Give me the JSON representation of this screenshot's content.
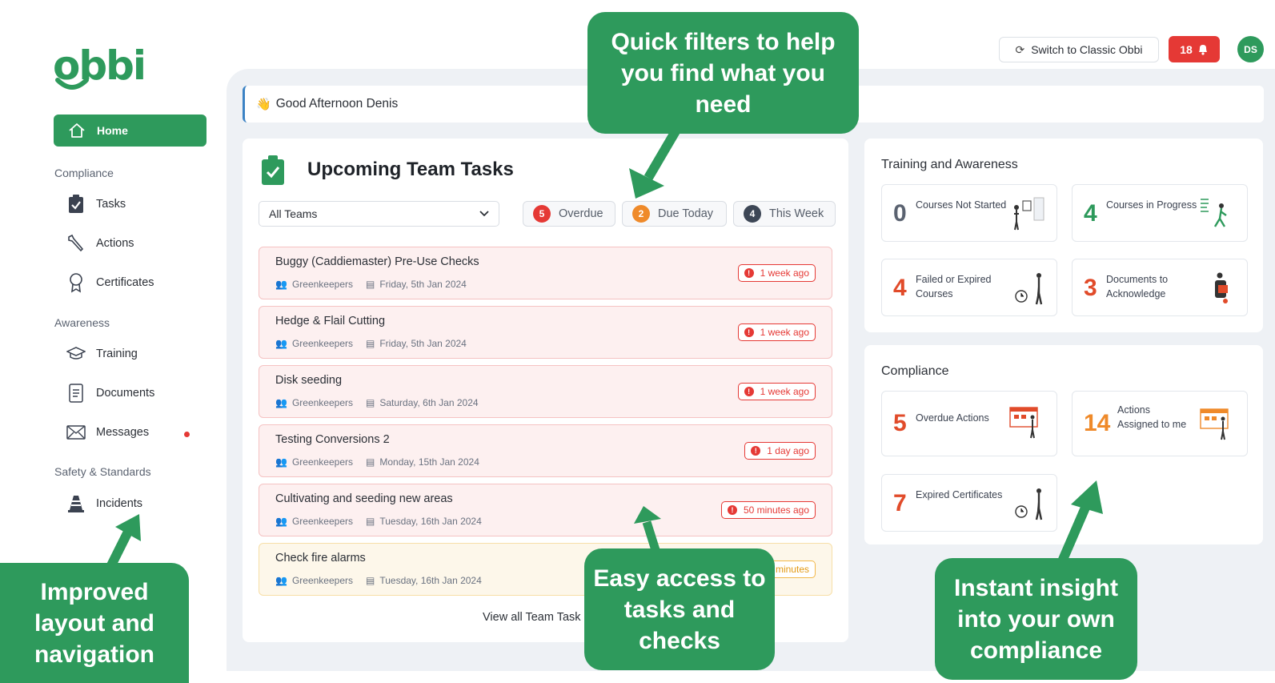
{
  "app": {
    "logo_text": "obbi",
    "brand_color": "#2e9a5c",
    "switch_label": "Switch to Classic Obbi",
    "notification_count": "18",
    "avatar_initials": "DS"
  },
  "sidebar": {
    "home_label": "Home",
    "sections": {
      "compliance": "Compliance",
      "awareness": "Awareness",
      "safety": "Safety & Standards"
    },
    "items": {
      "tasks": "Tasks",
      "actions": "Actions",
      "certificates": "Certificates",
      "training": "Training",
      "documents": "Documents",
      "messages": "Messages",
      "incidents": "Incidents"
    }
  },
  "greeting": {
    "text": "Good Afternoon Denis",
    "icon": "waving-hand-icon"
  },
  "tasks": {
    "title": "Upcoming Team Tasks",
    "team_select_value": "All Teams",
    "filters": [
      {
        "count": "5",
        "label": "Overdue",
        "color": "#e53935"
      },
      {
        "count": "2",
        "label": "Due Today",
        "color": "#ef8a2a"
      },
      {
        "count": "4",
        "label": "This Week",
        "color": "#3d4756"
      }
    ],
    "rows": [
      {
        "name": "Buggy (Caddiemaster) Pre-Use Checks",
        "team": "Greenkeepers",
        "date": "Friday, 5th Jan 2024",
        "status": "1 week ago"
      },
      {
        "name": "Hedge & Flail Cutting",
        "team": "Greenkeepers",
        "date": "Friday, 5th Jan 2024",
        "status": "1 week ago"
      },
      {
        "name": "Disk seeding",
        "team": "Greenkeepers",
        "date": "Saturday, 6th Jan 2024",
        "status": "1 week ago"
      },
      {
        "name": "Testing Conversions 2",
        "team": "Greenkeepers",
        "date": "Monday, 15th Jan 2024",
        "status": "1 day ago"
      },
      {
        "name": "Cultivating and seeding new areas",
        "team": "Greenkeepers",
        "date": "Tuesday, 16th Jan 2024",
        "status": "50 minutes ago"
      },
      {
        "name": "Check fire alarms",
        "team": "Greenkeepers",
        "date": "Tuesday, 16th Jan 2024",
        "status": "minutes"
      }
    ],
    "view_all": "View all Team Task"
  },
  "training": {
    "title": "Training and Awareness",
    "stats": [
      {
        "value": "0",
        "label": "Courses Not Started"
      },
      {
        "value": "4",
        "label": "Courses in Progress"
      },
      {
        "value": "4",
        "label": "Failed or Expired Courses"
      },
      {
        "value": "3",
        "label": "Documents to Acknowledge"
      }
    ]
  },
  "compliance": {
    "title": "Compliance",
    "stats": [
      {
        "value": "5",
        "label": "Overdue Actions"
      },
      {
        "value": "14",
        "label": "Actions Assigned to me"
      },
      {
        "value": "7",
        "label": "Expired Certificates"
      }
    ]
  },
  "callouts": {
    "filters": "Quick filters to help you find what you need",
    "navigation": "Improved layout and navigation",
    "tasks": "Easy access to tasks and checks",
    "insight": "Instant insight into your own compliance"
  }
}
